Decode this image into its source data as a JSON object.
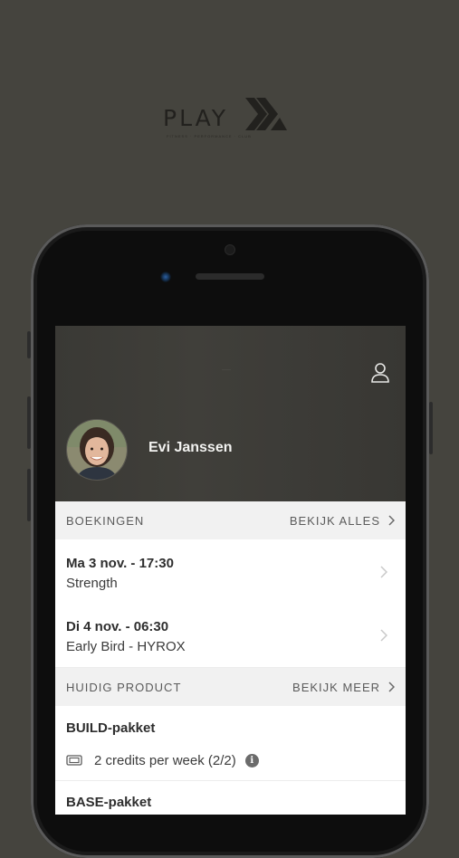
{
  "brand": {
    "logo_text": "PLAY",
    "tagline": "FITNESS · PERFORMANCE · CLUB"
  },
  "header": {
    "mini_label": "·····",
    "user_name": "Evi Janssen",
    "profile_icon": "user-outline-icon"
  },
  "bookings": {
    "section_label": "BOEKINGEN",
    "view_all_label": "BEKIJK ALLES",
    "items": [
      {
        "date": "Ma 3 nov. - 17:30",
        "class": "Strength"
      },
      {
        "date": "Di 4 nov. - 06:30",
        "class": "Early Bird - HYROX"
      }
    ]
  },
  "current_product": {
    "section_label": "HUIDIG PRODUCT",
    "view_more_label": "BEKIJK MEER",
    "products": [
      {
        "name": "BUILD-pakket",
        "credits": "2 credits per week (2/2)"
      },
      {
        "name": "BASE-pakket"
      }
    ]
  },
  "colors": {
    "background": "#45443e",
    "hero": "#3c3b37",
    "section_bg": "#f1f1f1"
  }
}
